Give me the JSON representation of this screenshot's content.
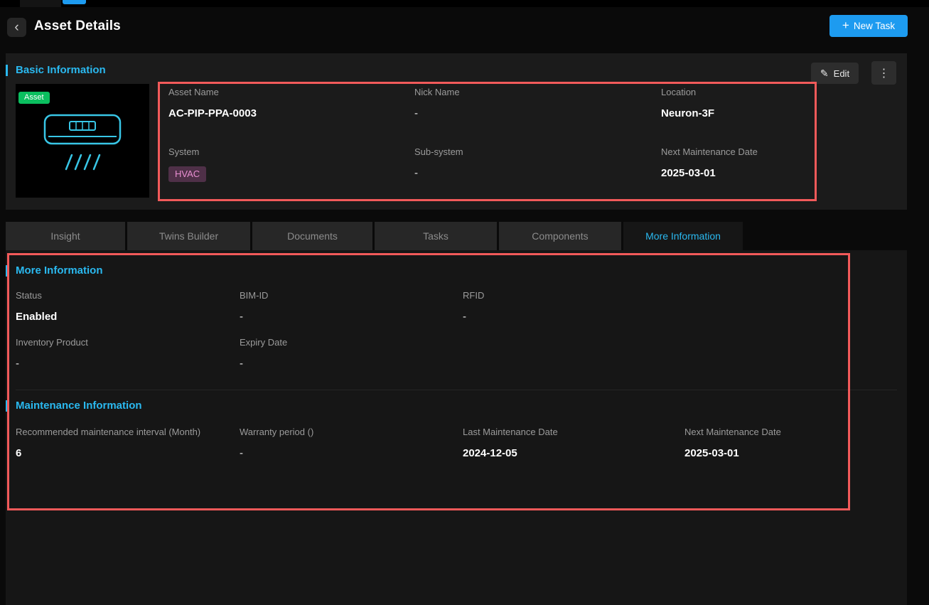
{
  "chrome": {
    "title": "Asset Details",
    "new_task_label": "New Task"
  },
  "icons": {
    "back": "‹",
    "plus": "+",
    "edit": "✎",
    "kebab": "⋮"
  },
  "basic_info": {
    "title": "Basic Information",
    "edit_label": "Edit",
    "asset_badge": "Asset",
    "fields": [
      {
        "label": "Asset Name",
        "value": "AC-PIP-PPA-0003"
      },
      {
        "label": "Nick Name",
        "value": "-"
      },
      {
        "label": "Location",
        "value": "Neuron-3F"
      },
      {
        "label": "System",
        "value": "HVAC"
      },
      {
        "label": "Sub-system",
        "value": "-"
      },
      {
        "label": "Next Maintenance Date",
        "value": "2025-03-01"
      }
    ]
  },
  "tabs": [
    {
      "label": "Insight",
      "active": false
    },
    {
      "label": "Twins Builder",
      "active": false
    },
    {
      "label": "Documents",
      "active": false
    },
    {
      "label": "Tasks",
      "active": false
    },
    {
      "label": "Components",
      "active": false
    },
    {
      "label": "More Information",
      "active": true
    }
  ],
  "more_information": {
    "title": "More Information",
    "fields": [
      {
        "label": "Status",
        "value": "Enabled"
      },
      {
        "label": "BIM-ID",
        "value": "-"
      },
      {
        "label": "RFID",
        "value": "-"
      },
      {
        "label": "Inventory Product",
        "value": "-"
      },
      {
        "label": "Expiry Date",
        "value": "-"
      }
    ]
  },
  "maintenance": {
    "title": "Maintenance Information",
    "fields": [
      {
        "label": "Recommended maintenance interval (Month)",
        "value": "6"
      },
      {
        "label": "Warranty period ()",
        "value": "-"
      },
      {
        "label": "Last Maintenance Date",
        "value": "2024-12-05"
      },
      {
        "label": "Next Maintenance Date",
        "value": "2025-03-01"
      }
    ]
  },
  "colors": {
    "accent_cyan": "#2ab9f0",
    "primary_blue": "#1d9bf0",
    "badge_green": "#0bbf5f",
    "hvac_badge_bg": "#4f3048",
    "hvac_badge_text": "#e98fd2",
    "annotation_red": "#f25a5a"
  }
}
